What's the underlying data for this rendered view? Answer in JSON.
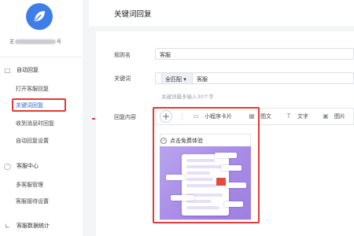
{
  "sidebar": {
    "account_prefix": "芝",
    "account_suffix": "号",
    "groups": [
      {
        "label": "自动回复",
        "icon": "chat-icon",
        "items": [
          {
            "label": "打开客服回复"
          },
          {
            "label": "关键词回复",
            "active": true
          },
          {
            "label": "收到消息时回复"
          },
          {
            "label": "自动回复设置"
          }
        ]
      },
      {
        "label": "客服中心",
        "icon": "headset-icon",
        "items": [
          {
            "label": "多客服管理"
          },
          {
            "label": "客服接待设置"
          }
        ]
      },
      {
        "label": "客服数据统计",
        "icon": "chart-icon",
        "items": []
      }
    ]
  },
  "header": {
    "title": "关键词回复"
  },
  "form": {
    "rule_name_label": "规则名",
    "rule_name_value": "客服",
    "keyword_label": "关键词",
    "match_mode": "全匹配",
    "keyword_value": "客服",
    "keyword_hint": "关键词最多输入30个字",
    "reply_label": "回复内容",
    "add_label": "+",
    "tools": [
      {
        "label": "小程序卡片",
        "icon": "miniapp-card-icon"
      },
      {
        "label": "图文",
        "icon": "article-icon"
      },
      {
        "label": "文字",
        "icon": "text-icon"
      },
      {
        "label": "图片",
        "icon": "image-icon"
      }
    ],
    "card_title": "点击免费体验"
  },
  "colors": {
    "accent": "#2a64d6",
    "highlight": "#e53935",
    "logo": "#3d7ee8",
    "card_bg": "#a88be6"
  }
}
